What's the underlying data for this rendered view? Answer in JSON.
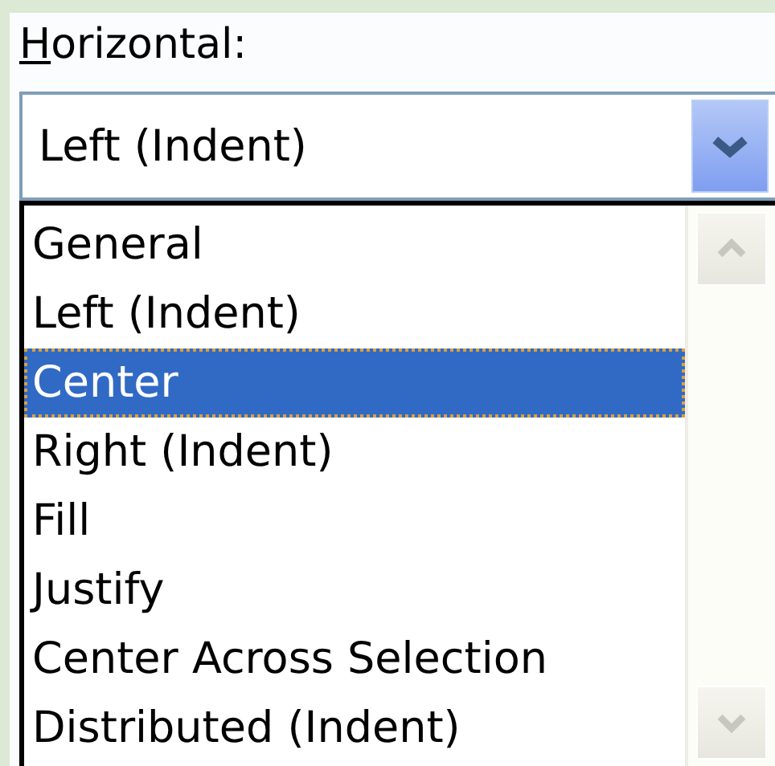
{
  "label": {
    "mnemonic": "H",
    "rest": "orizontal:"
  },
  "combo": {
    "value": "Left (Indent)"
  },
  "options": [
    {
      "label": "General",
      "selected": false
    },
    {
      "label": "Left (Indent)",
      "selected": false
    },
    {
      "label": "Center",
      "selected": true
    },
    {
      "label": "Right (Indent)",
      "selected": false
    },
    {
      "label": "Fill",
      "selected": false
    },
    {
      "label": "Justify",
      "selected": false
    },
    {
      "label": "Center Across Selection",
      "selected": false
    },
    {
      "label": "Distributed (Indent)",
      "selected": false
    }
  ]
}
